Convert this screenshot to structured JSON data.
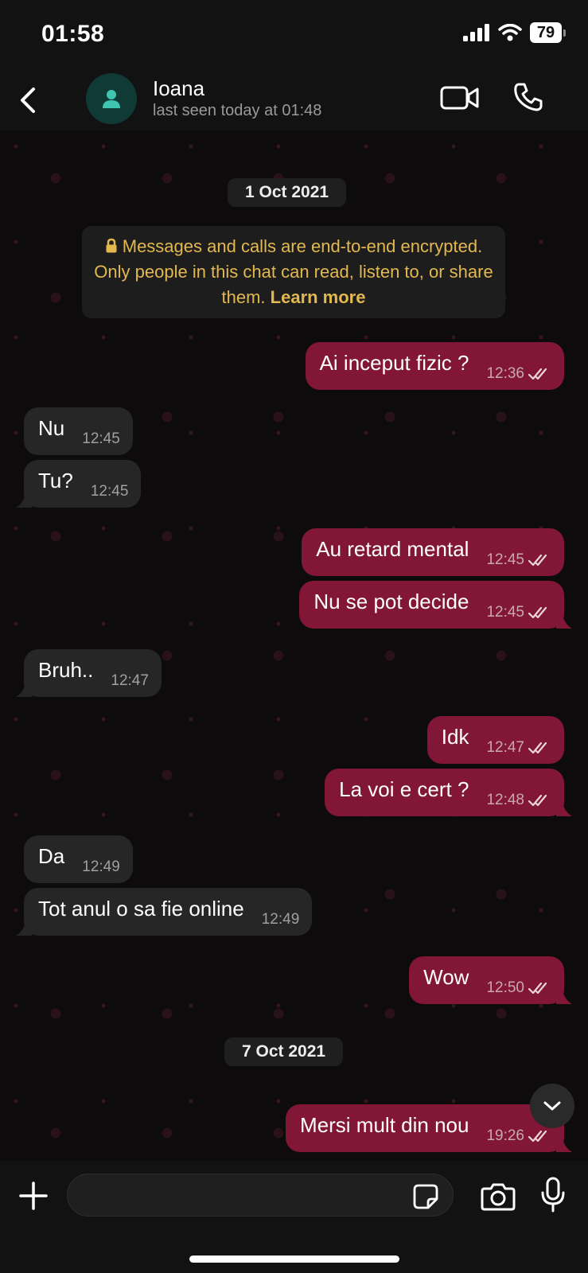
{
  "status_bar": {
    "time": "01:58",
    "battery": "79"
  },
  "header": {
    "name": "Ioana",
    "last_seen": "last seen today at 01:48"
  },
  "date_chips": [
    "1 Oct 2021",
    "7 Oct 2021"
  ],
  "encryption_notice": {
    "text": "Messages and calls are end-to-end encrypted. Only people in this chat can read, listen to, or share them.",
    "link": "Learn more"
  },
  "messages": [
    {
      "dir": "out",
      "text": "Ai inceput fizic ?",
      "time": "12:36"
    },
    {
      "dir": "in",
      "text": "Nu",
      "time": "12:45"
    },
    {
      "dir": "in",
      "text": "Tu?",
      "time": "12:45"
    },
    {
      "dir": "out",
      "text": "Au retard mental",
      "time": "12:45"
    },
    {
      "dir": "out",
      "text": "Nu se pot decide",
      "time": "12:45"
    },
    {
      "dir": "in",
      "text": "Bruh..",
      "time": "12:47"
    },
    {
      "dir": "out",
      "text": "Idk",
      "time": "12:47"
    },
    {
      "dir": "out",
      "text": "La voi e cert ?",
      "time": "12:48"
    },
    {
      "dir": "in",
      "text": "Da",
      "time": "12:49"
    },
    {
      "dir": "in",
      "text": "Tot anul o sa fie online",
      "time": "12:49"
    },
    {
      "dir": "out",
      "text": "Wow",
      "time": "12:50"
    },
    {
      "dir": "out",
      "text": "Mersi mult din nou",
      "time": "19:26"
    }
  ],
  "composer": {
    "value": "",
    "placeholder": ""
  },
  "colors": {
    "outgoing": "#821636",
    "incoming": "#262626",
    "accent": "#e3b84f"
  }
}
